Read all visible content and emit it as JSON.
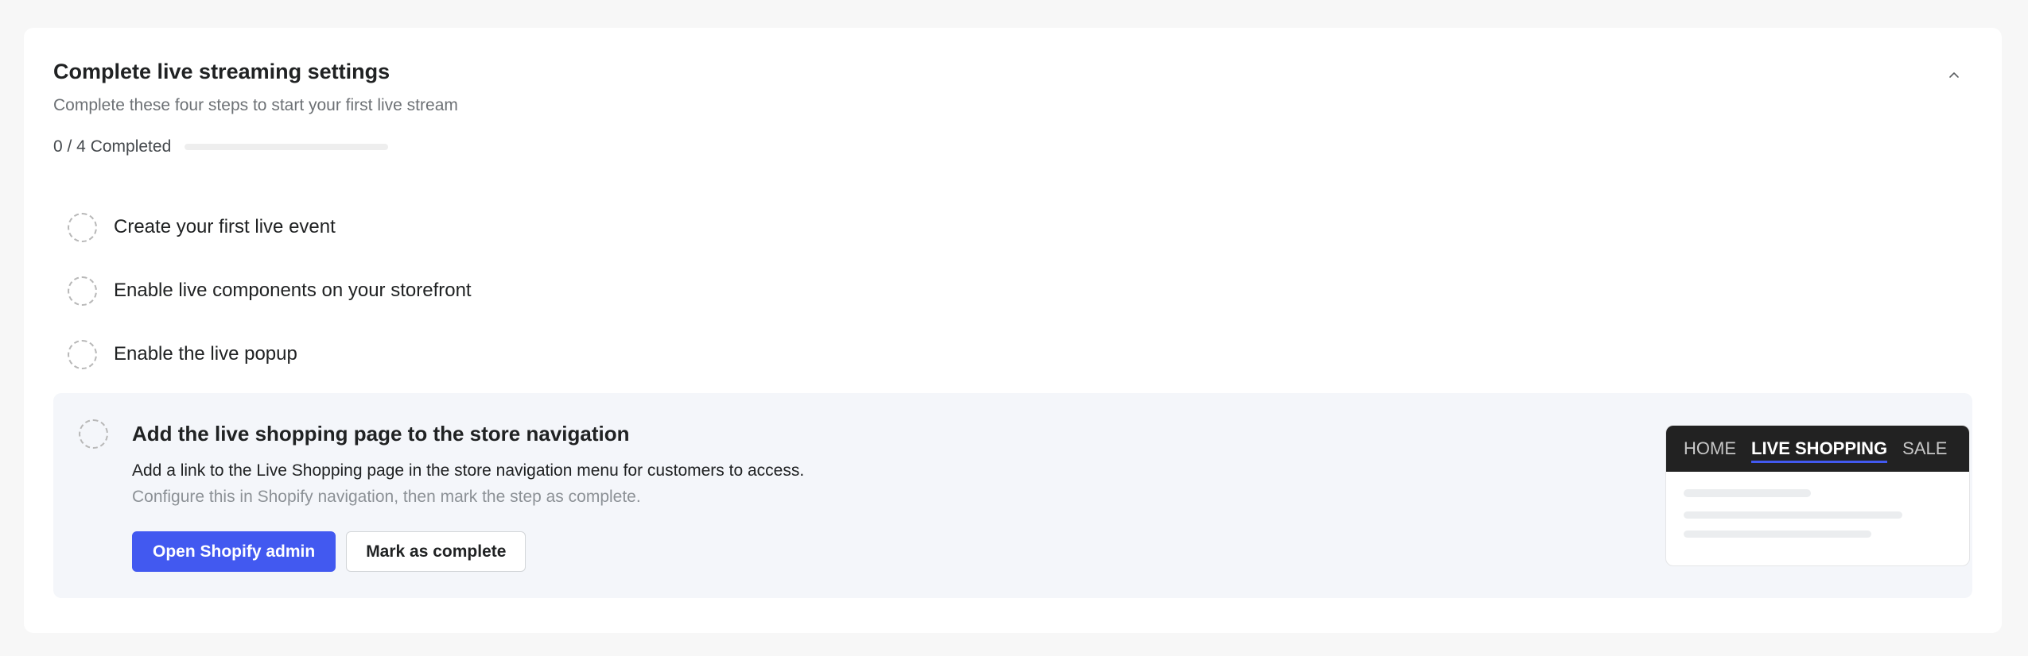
{
  "header": {
    "title": "Complete live streaming settings",
    "subtitle": "Complete these four steps to start your first live stream",
    "collapse_icon": "chevron-up-icon"
  },
  "progress": {
    "completed": 0,
    "total": 4,
    "label": "0 / 4 Completed",
    "fraction": 0
  },
  "steps": [
    {
      "label": "Create your first live event",
      "done": false
    },
    {
      "label": "Enable live components on your storefront",
      "done": false
    },
    {
      "label": "Enable the live popup",
      "done": false
    }
  ],
  "active_step": {
    "title": "Add the live shopping page to the store navigation",
    "description": "Add a link to the Live Shopping page in the store navigation menu for customers to access.",
    "hint": "Configure this in Shopify navigation, then mark the step as complete.",
    "primary_button": "Open Shopify admin",
    "secondary_button": "Mark as complete",
    "preview_nav": [
      "HOME",
      "LIVE SHOPPING",
      "SALE"
    ],
    "preview_active": "LIVE SHOPPING"
  },
  "colors": {
    "accent": "#4259f0",
    "preview_nav_bg": "#222222"
  }
}
